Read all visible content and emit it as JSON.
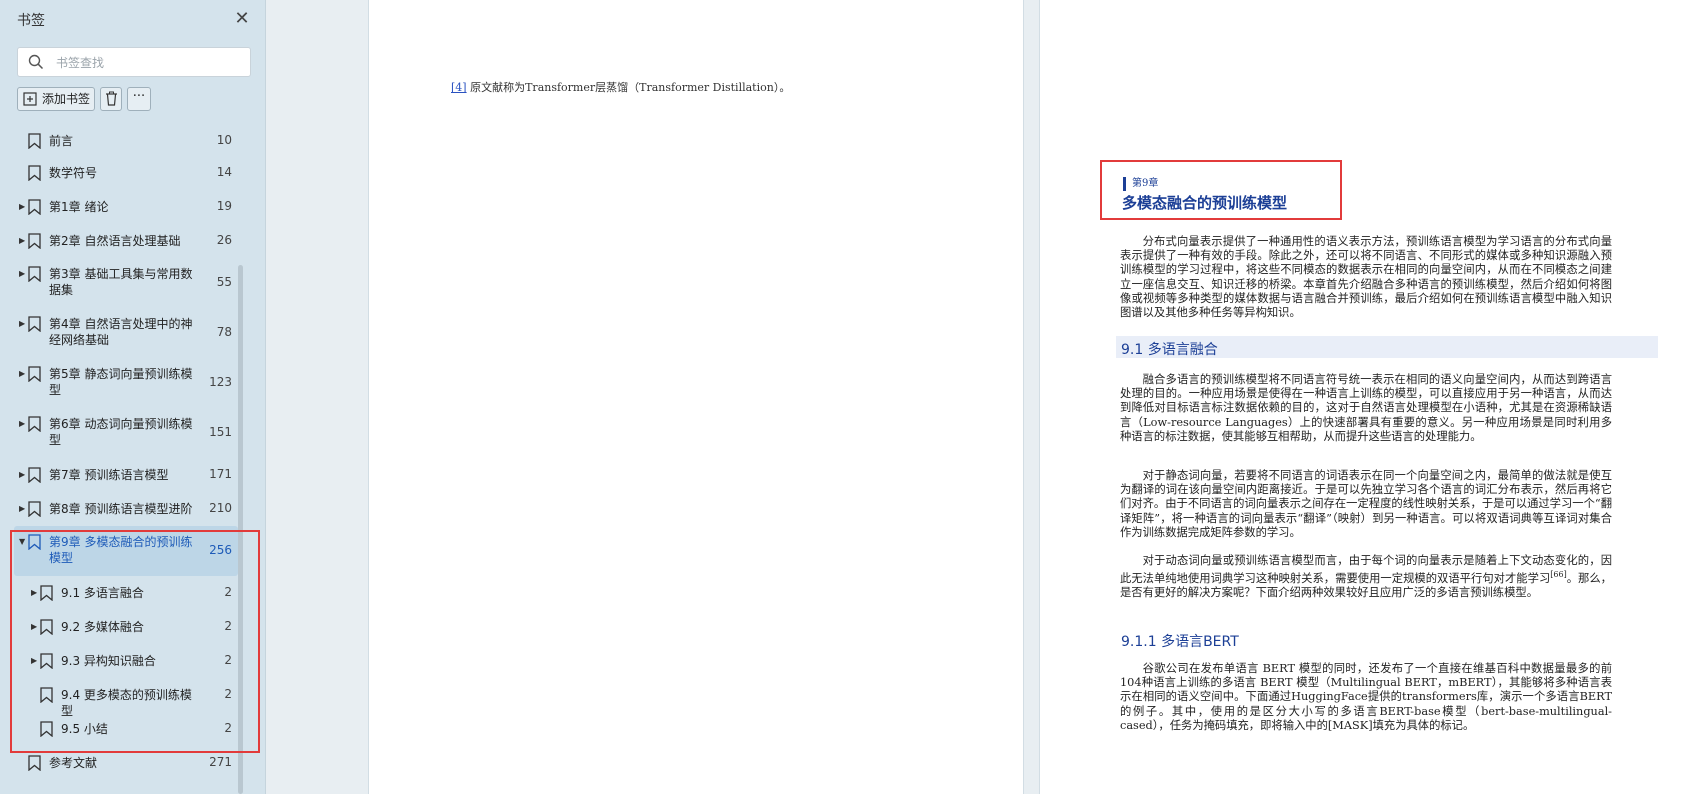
{
  "sidebar": {
    "title": "书签",
    "search_placeholder": "书签查找",
    "add_label": "添加书签",
    "more_label": "···",
    "items": [
      {
        "label": "前言",
        "page": "10",
        "expandable": false,
        "level": 0
      },
      {
        "label": "数学符号",
        "page": "14",
        "expandable": false,
        "level": 0
      },
      {
        "label": "第1章 绪论",
        "page": "19",
        "expandable": true,
        "level": 0
      },
      {
        "label": "第2章 自然语言处理基础",
        "page": "26",
        "expandable": true,
        "level": 0
      },
      {
        "label": "第3章 基础工具集与常用数据集",
        "page": "55",
        "expandable": true,
        "level": 0
      },
      {
        "label": "第4章 自然语言处理中的神经网络基础",
        "page": "78",
        "expandable": true,
        "level": 0
      },
      {
        "label": "第5章 静态词向量预训练模型",
        "page": "123",
        "expandable": true,
        "level": 0
      },
      {
        "label": "第6章 动态词向量预训练模型",
        "page": "151",
        "expandable": true,
        "level": 0
      },
      {
        "label": "第7章 预训练语言模型",
        "page": "171",
        "expandable": true,
        "level": 0
      },
      {
        "label": "第8章 预训练语言模型进阶",
        "page": "210",
        "expandable": true,
        "level": 0
      },
      {
        "label": "第9章 多模态融合的预训练模型",
        "page": "256",
        "expandable": true,
        "expanded": true,
        "active": true,
        "level": 0
      },
      {
        "label": "9.1 多语言融合",
        "page": "2",
        "expandable": true,
        "level": 1
      },
      {
        "label": "9.2 多媒体融合",
        "page": "2",
        "expandable": true,
        "level": 1
      },
      {
        "label": "9.3 异构知识融合",
        "page": "2",
        "expandable": true,
        "level": 1
      },
      {
        "label": "9.4 更多模态的预训练模型",
        "page": "2",
        "expandable": false,
        "level": 1
      },
      {
        "label": "9.5 小结",
        "page": "2",
        "expandable": false,
        "level": 1
      },
      {
        "label": "参考文献",
        "page": "271",
        "expandable": false,
        "level": 0
      }
    ]
  },
  "page_left": {
    "footnote_ref": "[4]",
    "footnote_text": "原文献称为Transformer层蒸馏（Transformer Distillation）。"
  },
  "page_right": {
    "chapter_tag": "第9章",
    "chapter_title": "多模态融合的预训练模型",
    "intro": "分布式向量表示提供了一种通用性的语义表示方法，预训练语言模型为学习语言的分布式向量表示提供了一种有效的手段。除此之外，还可以将不同语言、不同形式的媒体或多种知识源融入预训练模型的学习过程中，将这些不同模态的数据表示在相同的向量空间内，从而在不同模态之间建立一座信息交互、知识迁移的桥梁。本章首先介绍融合多种语言的预训练模型，然后介绍如何将图像或视频等多种类型的媒体数据与语言融合并预训练，最后介绍如何在预训练语言模型中融入知识图谱以及其他多种任务等异构知识。",
    "section_title": "9.1  多语言融合",
    "para1": "融合多语言的预训练模型将不同语言符号统一表示在相同的语义向量空间内，从而达到跨语言处理的目的。一种应用场景是使得在一种语言上训练的模型，可以直接应用于另一种语言，从而达到降低对目标语言标注数据依赖的目的，这对于自然语言处理模型在小语种，尤其是在资源稀缺语言（Low-resource Languages）上的快速部署具有重要的意义。另一种应用场景是同时利用多种语言的标注数据，使其能够互相帮助，从而提升这些语言的处理能力。",
    "para2": "对于静态词向量，若要将不同语言的词语表示在同一个向量空间之内，最简单的做法就是使互为翻译的词在该向量空间内距离接近。于是可以先独立学习各个语言的词汇分布表示，然后再将它们对齐。由于不同语言的词向量表示之间存在一定程度的线性映射关系，于是可以通过学习一个“翻译矩阵”，将一种语言的词向量表示“翻译”（映射）到另一种语言。可以将双语词典等互译词对集合作为训练数据完成矩阵参数的学习。",
    "para3_a": "对于动态词向量或预训练语言模型而言，由于每个词的向量表示是随着上下文动态变化的，因此无法单纯地使用词典学习这种映射关系，需要使用一定规模的双语平行句对才能学习",
    "para3_cite": "[66]",
    "para3_b": "。那么，是否有更好的解决方案呢？下面介绍两种效果较好且应用广泛的多语言预训练模型。",
    "subsection_title": "9.1.1  多语言BERT",
    "para4": "谷歌公司在发布单语言 BERT 模型的同时，还发布了一个直接在维基百科中数据量最多的前104种语言上训练的多语言 BERT 模型（Multilingual BERT，mBERT），其能够将多种语言表示在相同的语义空间中。下面通过HuggingFace提供的transformers库，演示一个多语言BERT的例子。其中，使用的是区分大小写的多语言BERT-base模型（bert-base-multilingual-cased），任务为掩码填充，即将输入中的[MASK]填充为具体的标记。"
  },
  "colors": {
    "sidebar_bg": "#d4e3ec",
    "active_text": "#1e5bb8",
    "heading_blue": "#1c3f96",
    "highlight_red": "#e23b3b"
  }
}
